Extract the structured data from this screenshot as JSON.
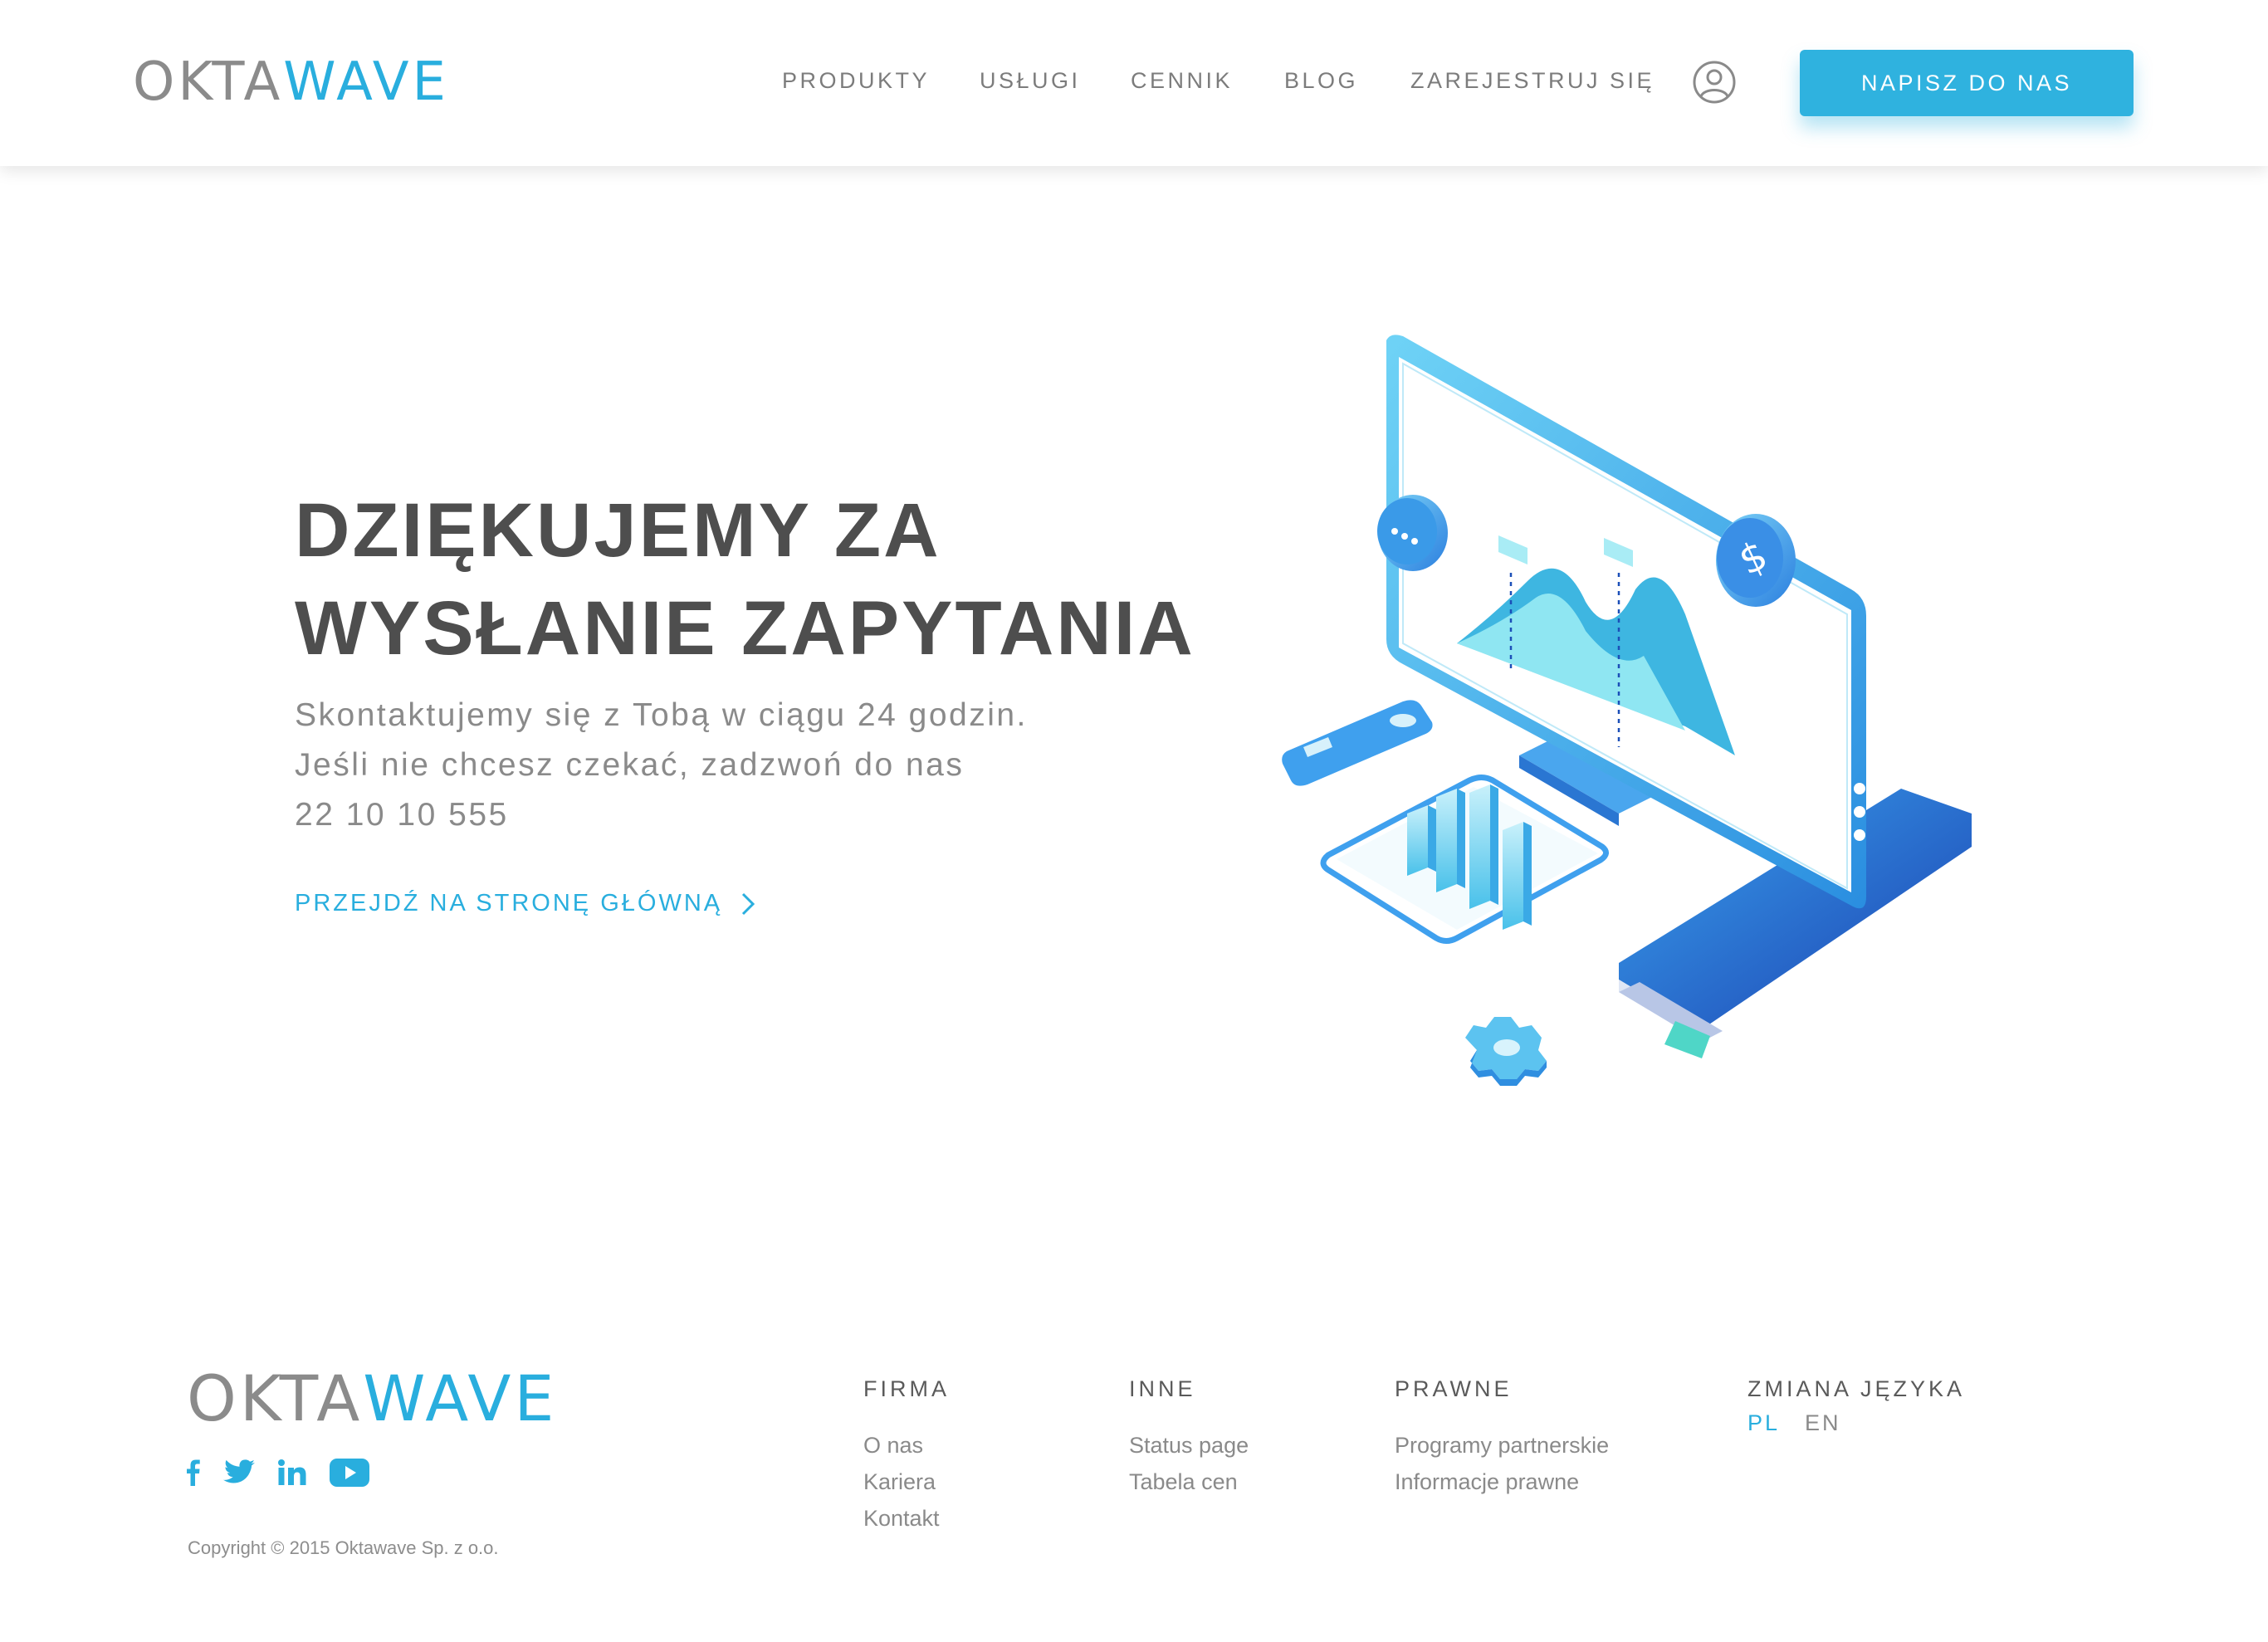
{
  "brand": {
    "part1": "OKTA",
    "part2": "WAVE",
    "color_gray": "#8b8b8b",
    "color_blue": "#29aede"
  },
  "nav": {
    "items": [
      {
        "label": "PRODUKTY"
      },
      {
        "label": "USŁUGI"
      },
      {
        "label": "CENNIK"
      },
      {
        "label": "BLOG"
      },
      {
        "label": "ZAREJESTRUJ SIĘ"
      }
    ],
    "account_icon": "user-circle-icon",
    "cta_label": "NAPISZ DO NAS"
  },
  "hero": {
    "title_line1": "DZIĘKUJEMY ZA",
    "title_line2": "WYSŁANIE ZAPYTANIA",
    "text_line1": "Skontaktujemy się z Tobą w ciągu 24 godzin.",
    "text_line2": "Jeśli nie chcesz czekać, zadzwoń do nas",
    "phone": "22 10 10 555",
    "home_link": "PRZEJDŹ NA STRONĘ GŁÓWNĄ",
    "illustration": "isometric-monitor-illustration"
  },
  "footer": {
    "social": [
      "facebook-icon",
      "twitter-icon",
      "linkedin-icon",
      "youtube-icon"
    ],
    "copyright": "Copyright © 2015 Oktawave Sp. z o.o.",
    "columns": [
      {
        "title": "FIRMA",
        "links": [
          "O nas",
          "Kariera",
          "Kontakt"
        ]
      },
      {
        "title": "INNE",
        "links": [
          "Status page",
          "Tabela cen"
        ]
      },
      {
        "title": "PRAWNE",
        "links": [
          "Programy partnerskie",
          "Informacje prawne"
        ]
      }
    ],
    "language": {
      "title": "ZMIANA JĘZYKA",
      "active": "PL",
      "other": "EN"
    }
  }
}
